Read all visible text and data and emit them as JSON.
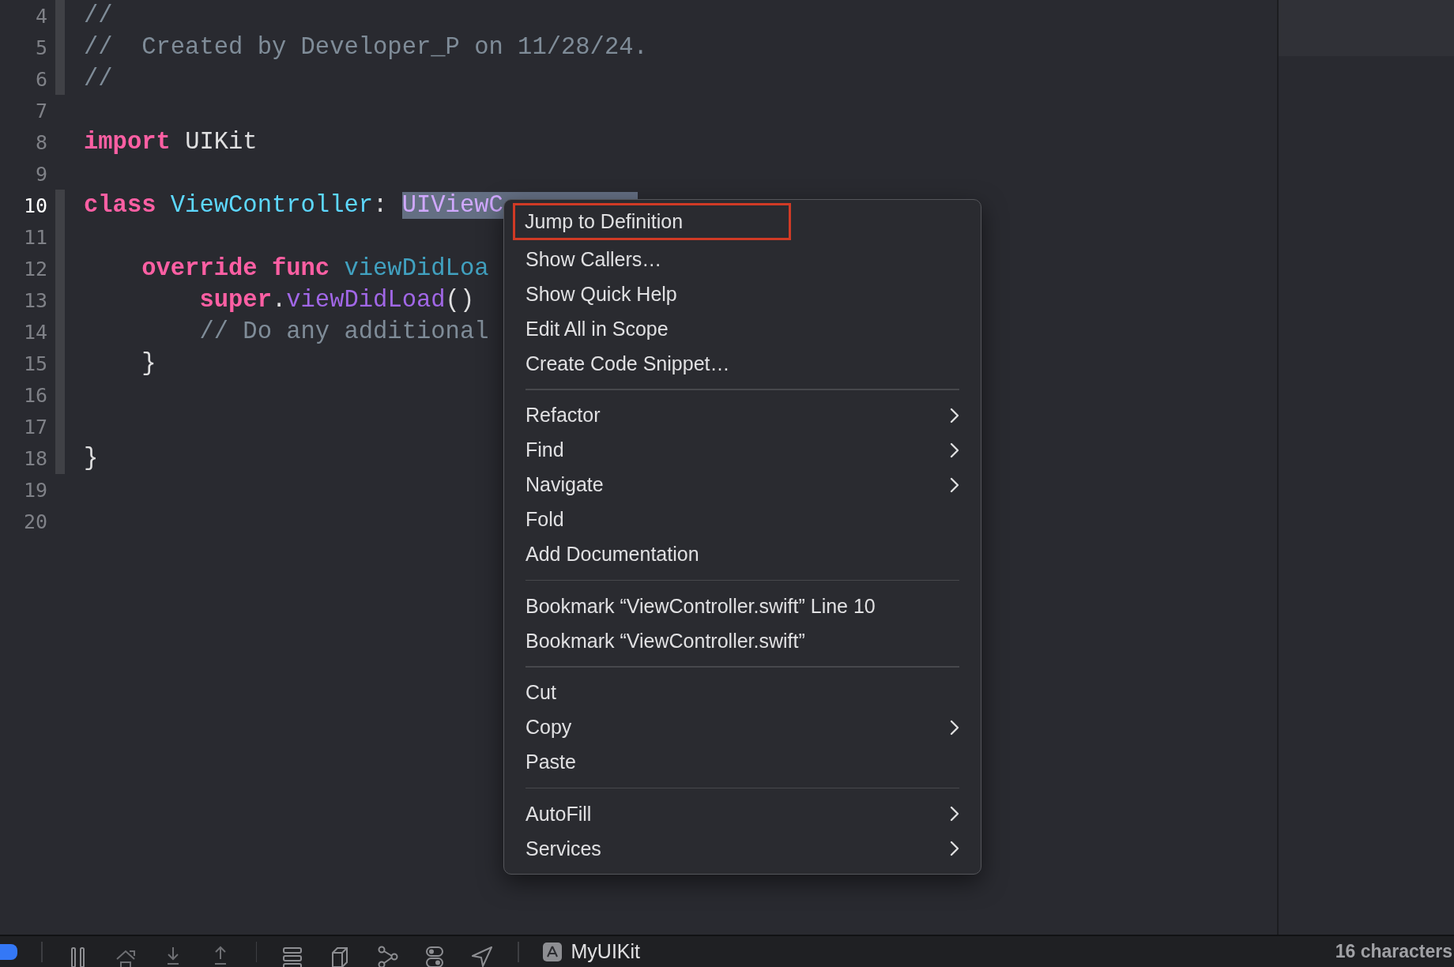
{
  "editor": {
    "lines": [
      {
        "number": "4",
        "current": false,
        "ribbon": true,
        "tokens": [
          {
            "text": "//",
            "kind": "comment",
            "selected": false
          }
        ]
      },
      {
        "number": "5",
        "current": false,
        "ribbon": true,
        "tokens": [
          {
            "text": "//  Created by Developer_P on 11/28/24.",
            "kind": "comment",
            "selected": false
          }
        ]
      },
      {
        "number": "6",
        "current": false,
        "ribbon": true,
        "tokens": [
          {
            "text": "//",
            "kind": "comment",
            "selected": false
          }
        ]
      },
      {
        "number": "7",
        "current": false,
        "ribbon": false
      },
      {
        "number": "8",
        "current": false,
        "ribbon": false,
        "tokens": [
          {
            "text": "import",
            "kind": "keyword",
            "selected": false
          },
          {
            "text": " UIKit",
            "kind": "plain",
            "selected": false
          }
        ]
      },
      {
        "number": "9",
        "current": false,
        "ribbon": false
      },
      {
        "number": "10",
        "current": true,
        "ribbon": true,
        "tokens": [
          {
            "text": "class",
            "kind": "keyword",
            "selected": false
          },
          {
            "text": " ViewController",
            "kind": "type",
            "selected": false
          },
          {
            "text": ": ",
            "kind": "plain",
            "selected": false
          },
          {
            "text": "UIViewC",
            "kind": "classref",
            "selected": true
          }
        ]
      },
      {
        "number": "11",
        "current": false,
        "ribbon": true
      },
      {
        "number": "12",
        "current": false,
        "ribbon": true,
        "tokens": [
          {
            "text": "    override",
            "kind": "keyword",
            "selected": false
          },
          {
            "text": " func",
            "kind": "keyword",
            "selected": false
          },
          {
            "text": " viewDidLoa",
            "kind": "func",
            "selected": false
          }
        ]
      },
      {
        "number": "13",
        "current": false,
        "ribbon": true,
        "tokens": [
          {
            "text": "        super",
            "kind": "keyword",
            "selected": false
          },
          {
            "text": ".",
            "kind": "plain",
            "selected": false
          },
          {
            "text": "viewDidLoad",
            "kind": "method",
            "selected": false
          },
          {
            "text": "()",
            "kind": "plain",
            "selected": false
          }
        ]
      },
      {
        "number": "14",
        "current": false,
        "ribbon": true,
        "tokens": [
          {
            "text": "        // Do any additional",
            "kind": "comment",
            "selected": false
          }
        ]
      },
      {
        "number": "15",
        "current": false,
        "ribbon": true,
        "tokens": [
          {
            "text": "    }",
            "kind": "plain",
            "selected": false
          }
        ]
      },
      {
        "number": "16",
        "current": false,
        "ribbon": true
      },
      {
        "number": "17",
        "current": false,
        "ribbon": true
      },
      {
        "number": "18",
        "current": false,
        "ribbon": true,
        "tokens": [
          {
            "text": "}",
            "kind": "plain",
            "selected": false
          }
        ]
      },
      {
        "number": "19",
        "current": false,
        "ribbon": false
      },
      {
        "number": "20",
        "current": false,
        "ribbon": false
      }
    ]
  },
  "context_menu": {
    "groups": [
      [
        {
          "label": "Jump to Definition",
          "submenu": false,
          "outlined": true
        },
        {
          "label": "Show Callers…",
          "submenu": false,
          "outlined": false
        },
        {
          "label": "Show Quick Help",
          "submenu": false,
          "outlined": false
        },
        {
          "label": "Edit All in Scope",
          "submenu": false,
          "outlined": false
        },
        {
          "label": "Create Code Snippet…",
          "submenu": false,
          "outlined": false
        }
      ],
      [
        {
          "label": "Refactor",
          "submenu": true,
          "outlined": false
        },
        {
          "label": "Find",
          "submenu": true,
          "outlined": false
        },
        {
          "label": "Navigate",
          "submenu": true,
          "outlined": false
        },
        {
          "label": "Fold",
          "submenu": false,
          "outlined": false
        },
        {
          "label": "Add Documentation",
          "submenu": false,
          "outlined": false
        }
      ],
      [
        {
          "label": "Bookmark “ViewController.swift” Line 10",
          "submenu": false,
          "outlined": false
        },
        {
          "label": "Bookmark “ViewController.swift”",
          "submenu": false,
          "outlined": false
        }
      ],
      [
        {
          "label": "Cut",
          "submenu": false,
          "outlined": false
        },
        {
          "label": "Copy",
          "submenu": true,
          "outlined": false
        },
        {
          "label": "Paste",
          "submenu": false,
          "outlined": false
        }
      ],
      [
        {
          "label": "AutoFill",
          "submenu": true,
          "outlined": false
        },
        {
          "label": "Services",
          "submenu": true,
          "outlined": false
        }
      ]
    ]
  },
  "debug_bar": {
    "scheme": "MyUIKit",
    "status": "16 characters"
  }
}
